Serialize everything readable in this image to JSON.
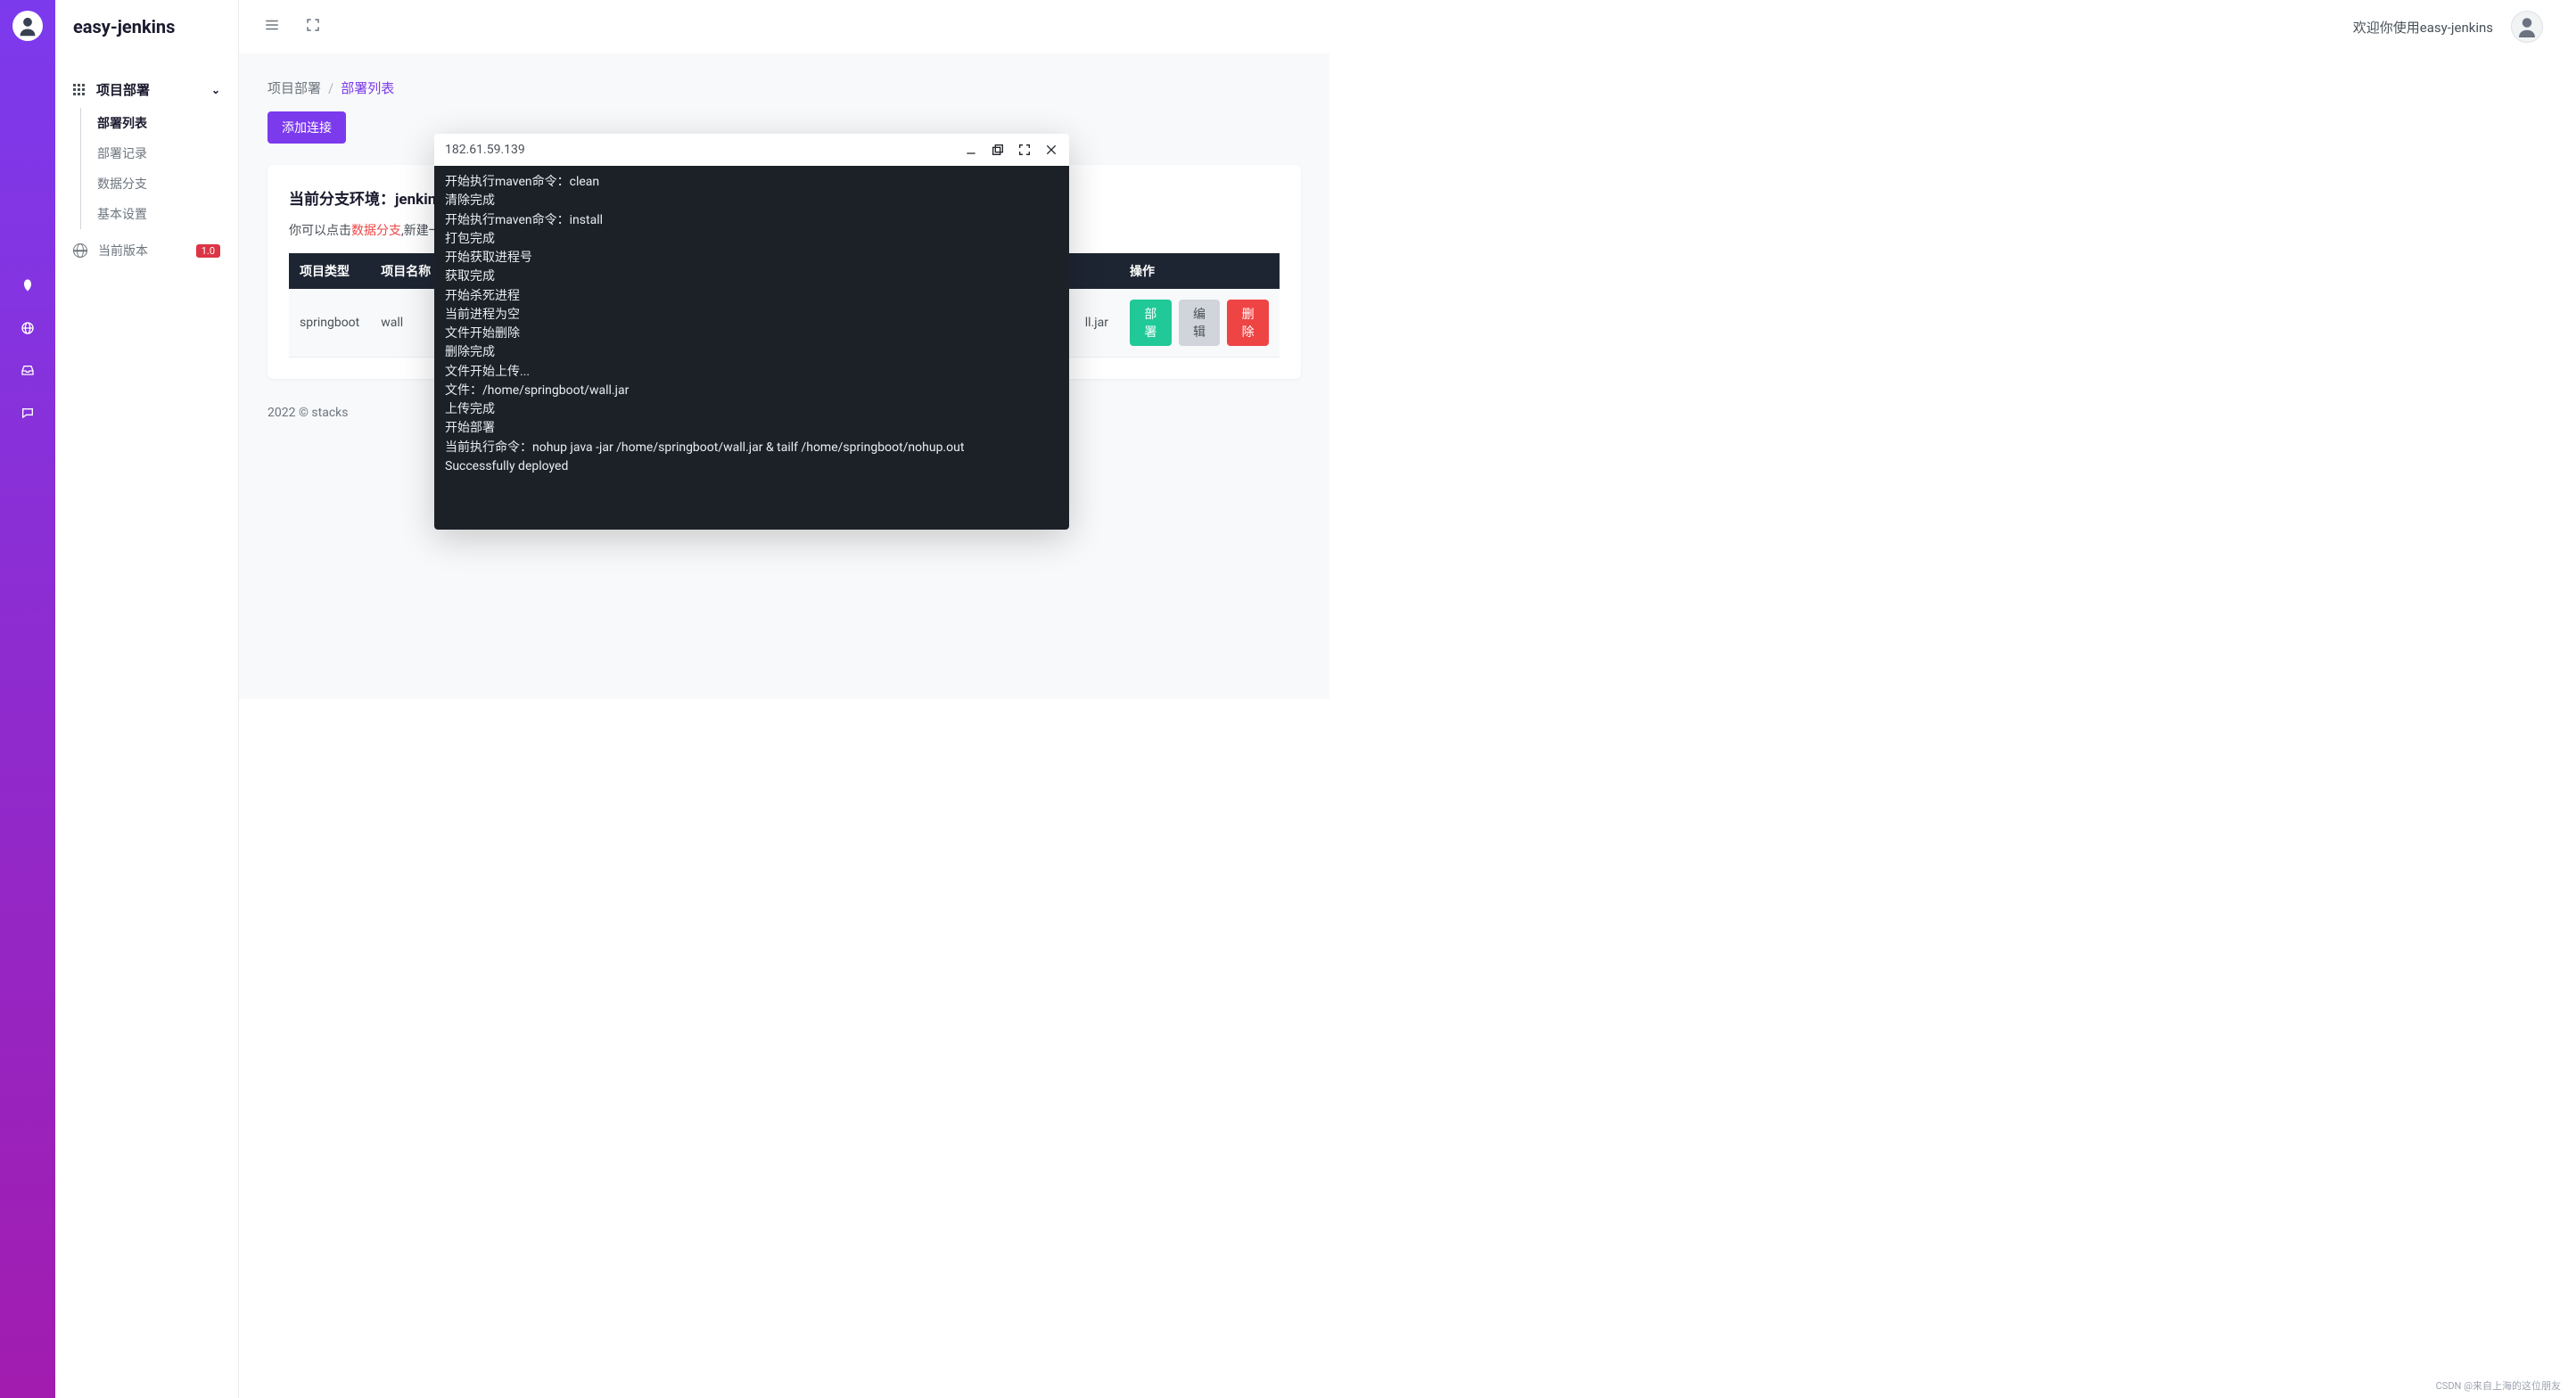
{
  "app": {
    "name": "easy-jenkins"
  },
  "topbar": {
    "welcome": "欢迎你使用easy-jenkins"
  },
  "sidebar": {
    "group_label": "项目部署",
    "items": [
      {
        "label": "部署列表",
        "active": true
      },
      {
        "label": "部署记录",
        "active": false
      },
      {
        "label": "数据分支",
        "active": false
      },
      {
        "label": "基本设置",
        "active": false
      }
    ],
    "version_label": "当前版本",
    "version_badge": "1.0"
  },
  "breadcrumb": {
    "root": "项目部署",
    "current": "部署列表"
  },
  "actions": {
    "add_connection": "添加连接"
  },
  "card": {
    "title_prefix": "当前分支环境：",
    "title_env": "jenkins",
    "tip_prefix": "你可以点击",
    "tip_link": "数据分支",
    "tip_suffix": ",新建一"
  },
  "table": {
    "headers": [
      "项目类型",
      "项目名称",
      "操作"
    ],
    "rows": [
      {
        "type": "springboot",
        "name": "wall",
        "file_tail": "ll.jar"
      }
    ],
    "action_labels": {
      "deploy": "部署",
      "edit": "编辑",
      "delete": "删除"
    }
  },
  "terminal": {
    "host": "182.61.59.139",
    "lines": [
      "开始执行maven命令：clean",
      "清除完成",
      "开始执行maven命令：install",
      "打包完成",
      "开始获取进程号",
      "获取完成",
      "开始杀死进程",
      "当前进程为空",
      "文件开始删除",
      "删除完成",
      "文件开始上传...",
      "文件：/home/springboot/wall.jar",
      "上传完成",
      "开始部署",
      "当前执行命令：nohup java -jar /home/springboot/wall.jar & tailf /home/springboot/nohup.out",
      "Successfully deployed"
    ]
  },
  "footer": {
    "text": "2022 © stacks"
  },
  "watermark": {
    "text": "CSDN @来自上海的这位朋友"
  }
}
